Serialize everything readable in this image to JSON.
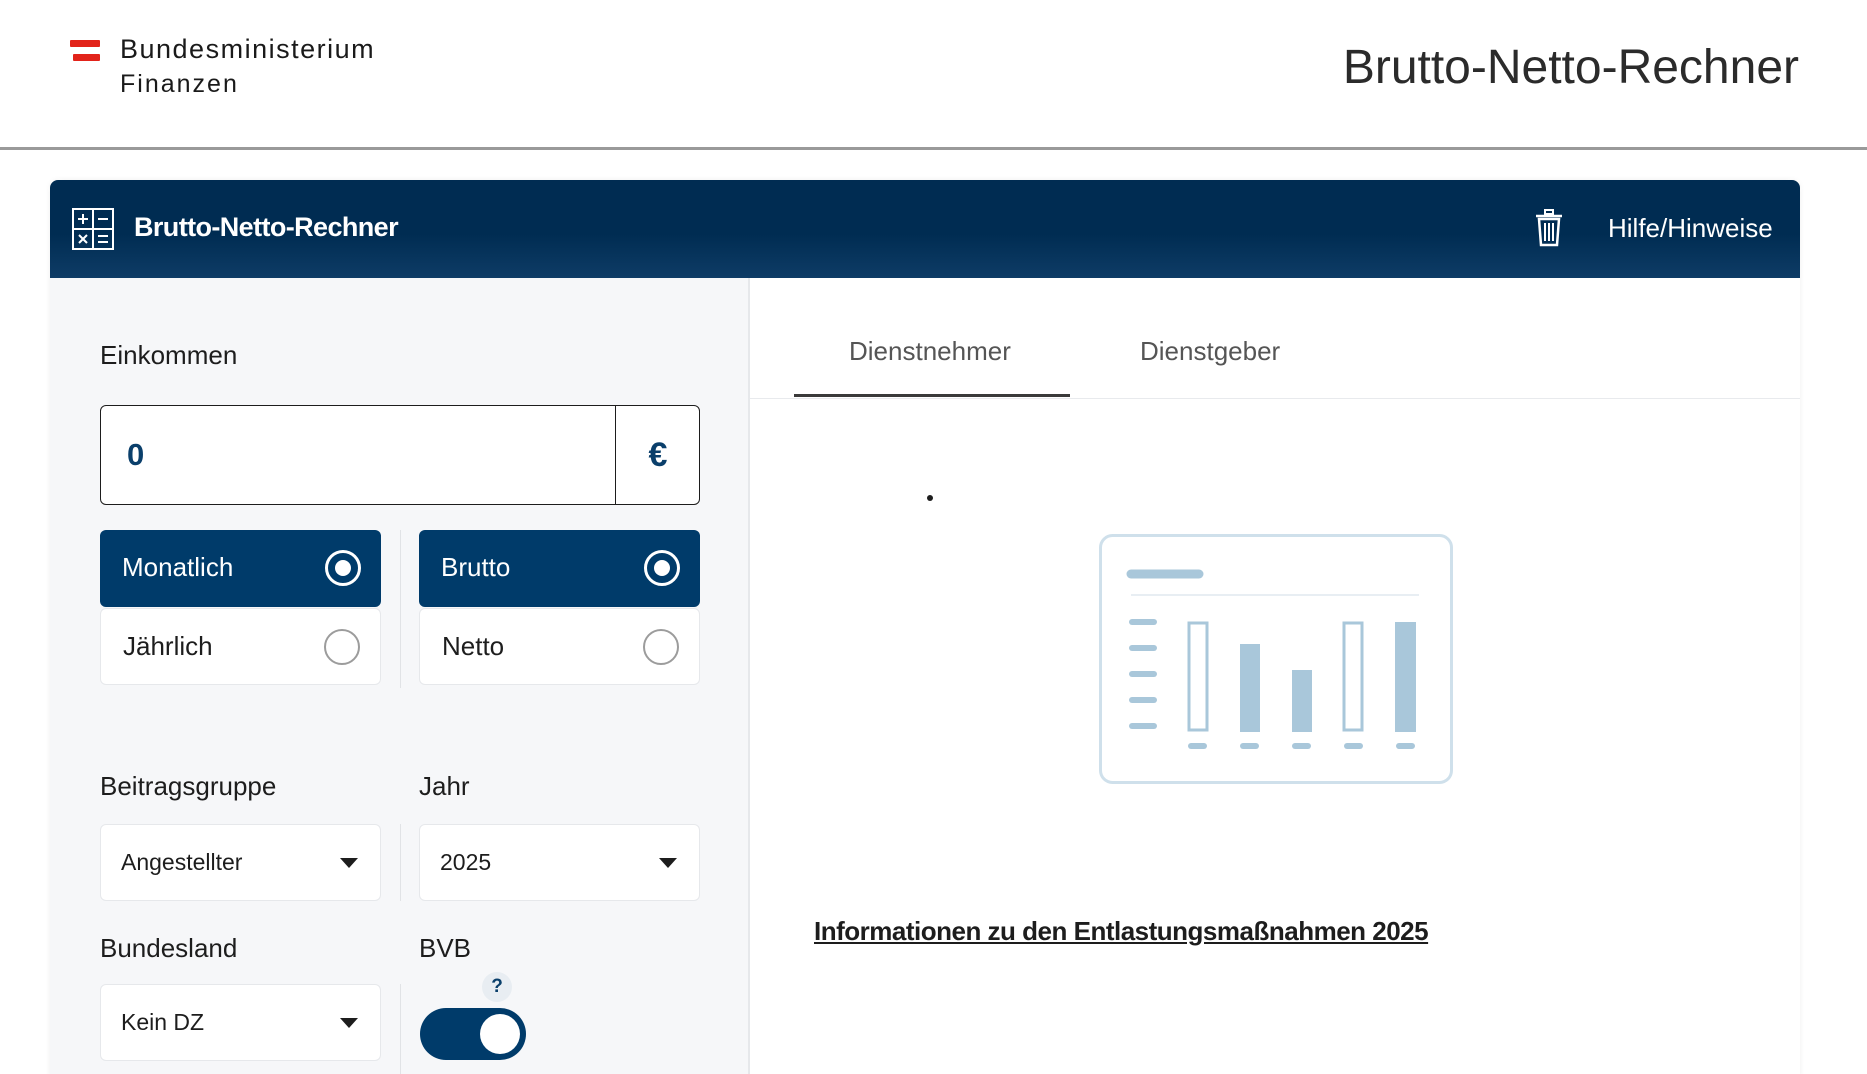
{
  "header": {
    "logo_line1": "Bundesministerium",
    "logo_line2": "Finanzen",
    "title": "Brutto-Netto-Rechner"
  },
  "toolbar": {
    "title": "Brutto-Netto-Rechner",
    "help_label": "Hilfe/Hinweise",
    "calc_icon": "calculator-icon",
    "trash_icon": "trash-icon"
  },
  "form": {
    "income_label": "Einkommen",
    "income_value": "0",
    "currency": "€",
    "period_options": [
      {
        "label": "Monatlich",
        "selected": true
      },
      {
        "label": "Jährlich",
        "selected": false
      }
    ],
    "type_options": [
      {
        "label": "Brutto",
        "selected": true
      },
      {
        "label": "Netto",
        "selected": false
      }
    ],
    "group_label": "Beitragsgruppe",
    "group_value": "Angestellter",
    "year_label": "Jahr",
    "year_value": "2025",
    "state_label": "Bundesland",
    "state_value": "Kein DZ",
    "bvb_label": "BVB",
    "bvb_help": "?",
    "bvb_enabled": true
  },
  "results": {
    "tabs": [
      {
        "label": "Dienstnehmer",
        "active": true
      },
      {
        "label": "Dienstgeber",
        "active": false
      }
    ],
    "info_link": "Informationen zu den Entlastungsmaßnahmen 2025"
  },
  "colors": {
    "primary": "#003b6a",
    "header_bar": "#002c52",
    "accent_red": "#e2231a",
    "illustration": "#a9c7da"
  }
}
